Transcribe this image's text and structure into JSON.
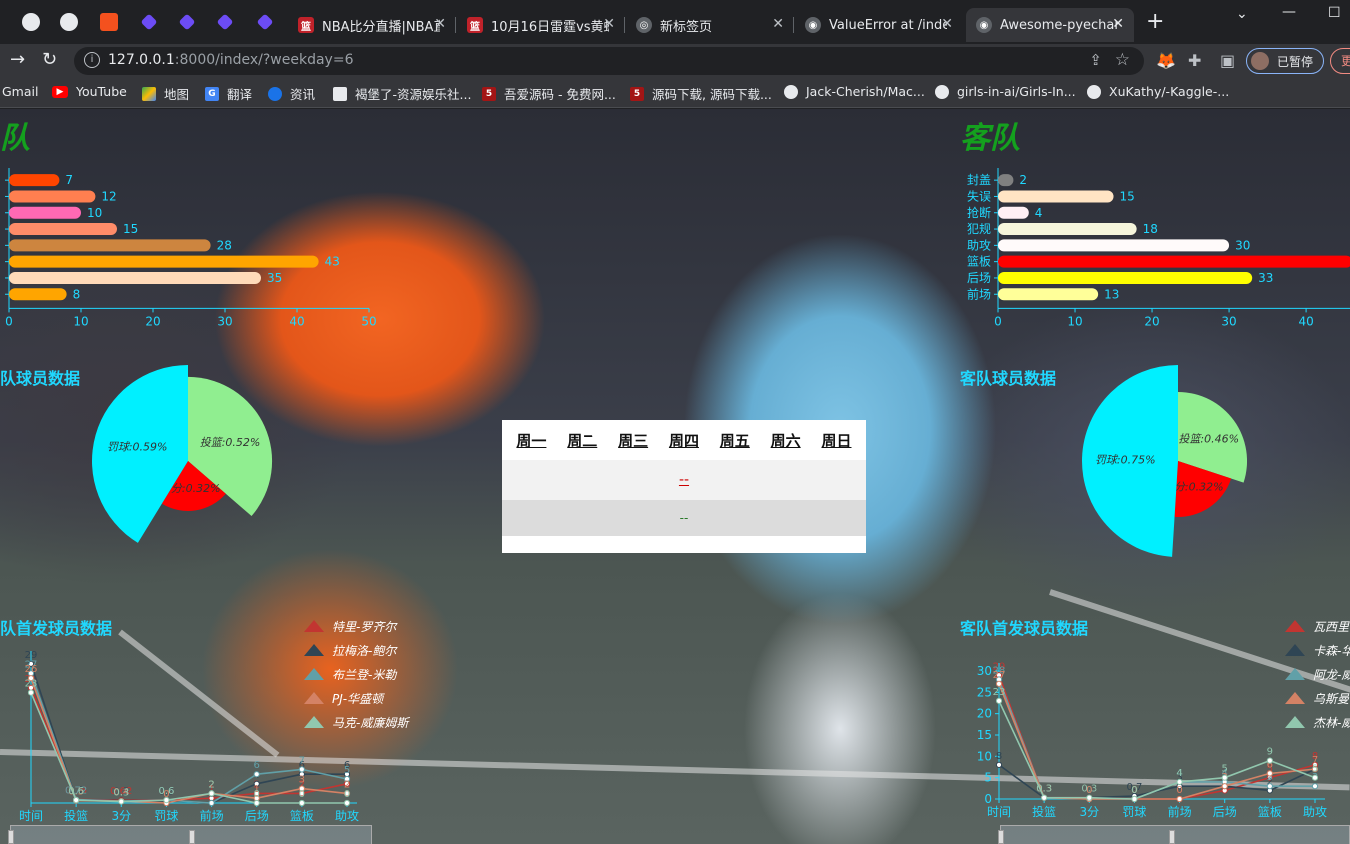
{
  "browser": {
    "tabs": [
      {
        "title": "NBA比分直播|NBA直",
        "fav_color": "#c0222a",
        "fav_glyph": "篮"
      },
      {
        "title": "10月16日雷霆vs黄蜂",
        "fav_color": "#c0222a",
        "fav_glyph": "篮"
      },
      {
        "title": "新标签页",
        "fav_color": "#5f6368",
        "fav_glyph": "◎"
      },
      {
        "title": "ValueError at /inde",
        "fav_color": "#5f6368",
        "fav_glyph": "◉"
      },
      {
        "title": "Awesome-pyecharts",
        "fav_color": "#5f6368",
        "fav_glyph": "◉"
      }
    ],
    "url_host": "127.0.0.1",
    "url_rest": ":8000/index/?weekday=6",
    "profile_label": "已暂停",
    "update_label": "更",
    "bookmarks": [
      {
        "label": "Gmail",
        "color": "#ea4335",
        "glyph": ""
      },
      {
        "label": "YouTube",
        "color": "#ff0000",
        "glyph": "▶"
      },
      {
        "label": "地图",
        "color": "#34a853",
        "glyph": ""
      },
      {
        "label": "翻译",
        "color": "#4285f4",
        "glyph": "G"
      },
      {
        "label": "资讯",
        "color": "#5f6368",
        "glyph": ""
      },
      {
        "label": "褐堡了-资源娱乐社...",
        "color": "#e8eaed",
        "glyph": ""
      },
      {
        "label": "吾爱源码 - 免费网...",
        "color": "#a31515",
        "glyph": "5"
      },
      {
        "label": "源码下载, 源码下载...",
        "color": "#a31515",
        "glyph": "5"
      },
      {
        "label": "Jack-Cherish/Mac...",
        "color": "#e8eaed",
        "glyph": ""
      },
      {
        "label": "girls-in-ai/Girls-In...",
        "color": "#e8eaed",
        "glyph": ""
      },
      {
        "label": "XuKathy/-Kaggle-...",
        "color": "#e8eaed",
        "glyph": ""
      }
    ]
  },
  "page": {
    "home_title": "队",
    "away_title": "客队",
    "home_players_title": "队球员数据",
    "away_players_title": "客队球员数据",
    "home_starters_title": "队首发球员数据",
    "away_starters_title": "客队首发球员数据",
    "weekdays": [
      "周一",
      "周二",
      "周三",
      "周四",
      "周五",
      "周六",
      "周日"
    ],
    "row2_text": "--",
    "row3_text": "--"
  },
  "chart_data": [
    {
      "type": "bar",
      "orientation": "horizontal",
      "title": "",
      "categories": [
        "",
        "",
        "",
        "",
        "",
        "",
        "",
        ""
      ],
      "values": [
        7,
        12,
        10,
        15,
        28,
        43,
        35,
        8
      ],
      "colors": [
        "#ff4500",
        "#ff7f50",
        "#ff69b4",
        "#ff8c69",
        "#cd853f",
        "#ffa500",
        "#ffdab9",
        "#ffa500"
      ],
      "xlim": [
        0,
        50
      ],
      "xticks": [
        0,
        10,
        20,
        30,
        40,
        50
      ]
    },
    {
      "type": "bar",
      "orientation": "horizontal",
      "title": "",
      "categories": [
        "封盖",
        "失误",
        "抢断",
        "犯规",
        "助攻",
        "篮板",
        "后场",
        "前场"
      ],
      "values": [
        2,
        15,
        4,
        18,
        30,
        46,
        33,
        13
      ],
      "colors": [
        "#808080",
        "#ffe4c4",
        "#fff0f5",
        "#f5f5dc",
        "#fffafa",
        "#ff0000",
        "#ffff00",
        "#ffff99"
      ],
      "xlim": [
        0,
        47
      ],
      "xticks": [
        0,
        10,
        20,
        30,
        40
      ]
    },
    {
      "type": "pie",
      "rose": true,
      "slices": [
        {
          "label": "投篮",
          "value": 0.52,
          "text": "投篮:0.52%",
          "color": "#90ee90"
        },
        {
          "label": "3分",
          "value": 0.32,
          "text": "3分:0.32%",
          "color": "#ff0000"
        },
        {
          "label": "罚球",
          "value": 0.59,
          "text": "罚球:0.59%",
          "color": "#00f0ff"
        }
      ]
    },
    {
      "type": "pie",
      "rose": true,
      "slices": [
        {
          "label": "投篮",
          "value": 0.46,
          "text": "投篮:0.46%",
          "color": "#90ee90"
        },
        {
          "label": "3分",
          "value": 0.32,
          "text": "3分:0.32%",
          "color": "#ff0000"
        },
        {
          "label": "罚球",
          "value": 0.75,
          "text": "罚球:0.75%",
          "color": "#00f0ff"
        }
      ]
    },
    {
      "type": "line",
      "categories": [
        "时间",
        "投篮",
        "3分",
        "罚球",
        "前场",
        "后场",
        "篮板",
        "助攻"
      ],
      "ylim": [
        0,
        30
      ],
      "series": [
        {
          "name": "特里-罗齐尔",
          "color": "#c23531",
          "values": [
            24,
            0.75,
            0.62,
            0.6,
            1,
            2,
            2,
            4
          ]
        },
        {
          "name": "拉梅洛-鲍尔",
          "color": "#2f4554",
          "values": [
            29,
            0.7,
            0.5,
            0.5,
            0,
            4,
            6,
            6
          ]
        },
        {
          "name": "布兰登-米勒",
          "color": "#61a0a8",
          "values": [
            27,
            0.72,
            0.4,
            0.6,
            0,
            6,
            7,
            5
          ]
        },
        {
          "name": "PJ-华盛顿",
          "color": "#d48265",
          "values": [
            26,
            0.5,
            0.4,
            0.0,
            2,
            1,
            3,
            2
          ]
        },
        {
          "name": "马克-威廉姆斯",
          "color": "#91c7ae",
          "values": [
            23,
            0.6,
            0.3,
            0.6,
            2,
            0,
            0,
            0
          ]
        }
      ],
      "point_labels": [
        "29",
        "0.75",
        "0.62",
        "0.6",
        "2",
        "6",
        "7",
        "6"
      ]
    },
    {
      "type": "line",
      "categories": [
        "时间",
        "投篮",
        "3分",
        "罚球",
        "前场",
        "后场",
        "篮板",
        "助攻"
      ],
      "ylim": [
        0,
        30
      ],
      "yticks": [
        0,
        5,
        10,
        15,
        20,
        25,
        30
      ],
      "series": [
        {
          "name": "瓦西里",
          "color": "#c23531",
          "values": [
            29,
            0.3,
            0.3,
            0.0,
            0,
            2,
            5,
            8
          ]
        },
        {
          "name": "卡森-华",
          "color": "#2f4554",
          "values": [
            8,
            0.3,
            0.3,
            0.7,
            3,
            3,
            2,
            7
          ]
        },
        {
          "name": "阿龙-威",
          "color": "#61a0a8",
          "values": [
            28,
            0.3,
            0.0,
            0.0,
            4,
            4,
            3,
            3
          ]
        },
        {
          "name": "乌斯曼",
          "color": "#d48265",
          "values": [
            27,
            0.3,
            0.0,
            0.0,
            0,
            3,
            6,
            7
          ]
        },
        {
          "name": "杰林-威",
          "color": "#91c7ae",
          "values": [
            23,
            0.3,
            0.3,
            0.0,
            4,
            5,
            9,
            5
          ]
        }
      ]
    }
  ]
}
